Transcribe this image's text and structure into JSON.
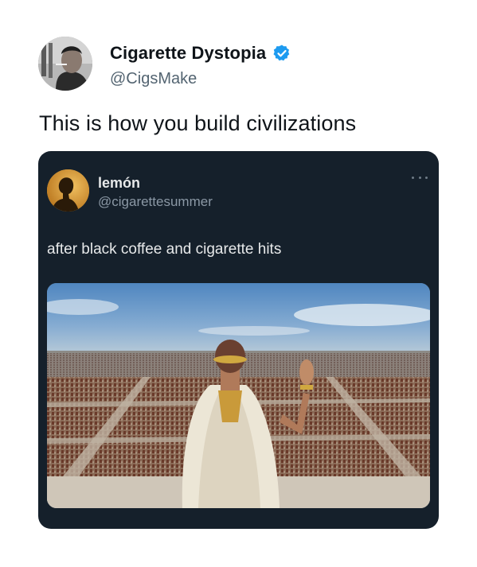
{
  "tweet": {
    "author": {
      "display_name": "Cigarette Dystopia",
      "handle": "@CigsMake",
      "verified": true,
      "avatar_icon": "profile-photo-man-with-cigarette"
    },
    "text": "This is how you build civilizations"
  },
  "quoted_tweet": {
    "author": {
      "display_name": "lemón",
      "handle": "@cigarettesummer",
      "avatar_icon": "profile-photo-silhouette"
    },
    "text": "after black coffee and cigarette hits",
    "more_icon": "more-horizontal-icon",
    "media": {
      "description_icon": "roman-emperor-army-image"
    }
  },
  "colors": {
    "verified_blue": "#1d9bf0",
    "card_bg": "#15202b",
    "text_primary": "#0f1419",
    "text_secondary": "#536471"
  }
}
